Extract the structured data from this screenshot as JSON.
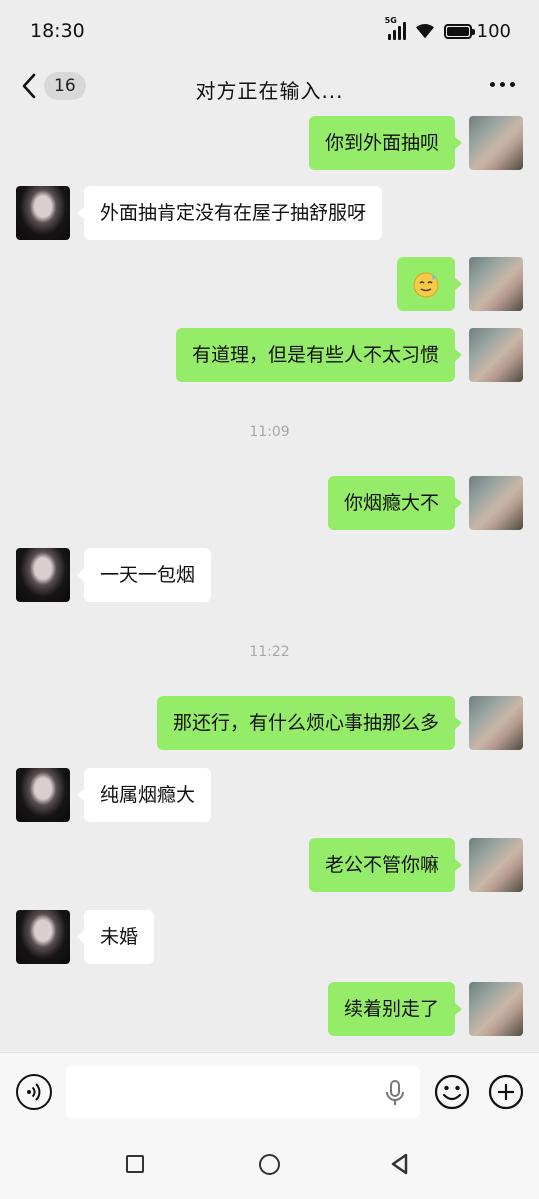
{
  "status_bar": {
    "time": "18:30",
    "network": "5G",
    "battery": "100"
  },
  "nav": {
    "unread_count": "16",
    "title": "对方正在输入..."
  },
  "messages": [
    {
      "side": "right",
      "text": "你到外面抽呗"
    },
    {
      "side": "left",
      "text": "外面抽肯定没有在屋子抽舒服呀"
    },
    {
      "side": "right",
      "emoji": "sweat-smile-emoji"
    },
    {
      "side": "right",
      "text": "有道理，但是有些人不太习惯"
    },
    {
      "timestamp": "11:09"
    },
    {
      "side": "right",
      "text": "你烟瘾大不"
    },
    {
      "side": "left",
      "text": "一天一包烟"
    },
    {
      "timestamp": "11:22"
    },
    {
      "side": "right",
      "text": "那还行，有什么烦心事抽那么多"
    },
    {
      "side": "left",
      "text": "纯属烟瘾大"
    },
    {
      "side": "right",
      "text": "老公不管你嘛"
    },
    {
      "side": "left",
      "text": "未婚"
    },
    {
      "side": "right",
      "text": "续着别走了"
    }
  ],
  "colors": {
    "sent_bubble": "#95ec69",
    "received_bubble": "#ffffff",
    "background": "#ededed"
  },
  "input_bar": {
    "left_icon": "voice-icon",
    "right_icons": [
      "emoji-icon",
      "plus-icon"
    ],
    "inline_icon": "microphone-icon"
  }
}
